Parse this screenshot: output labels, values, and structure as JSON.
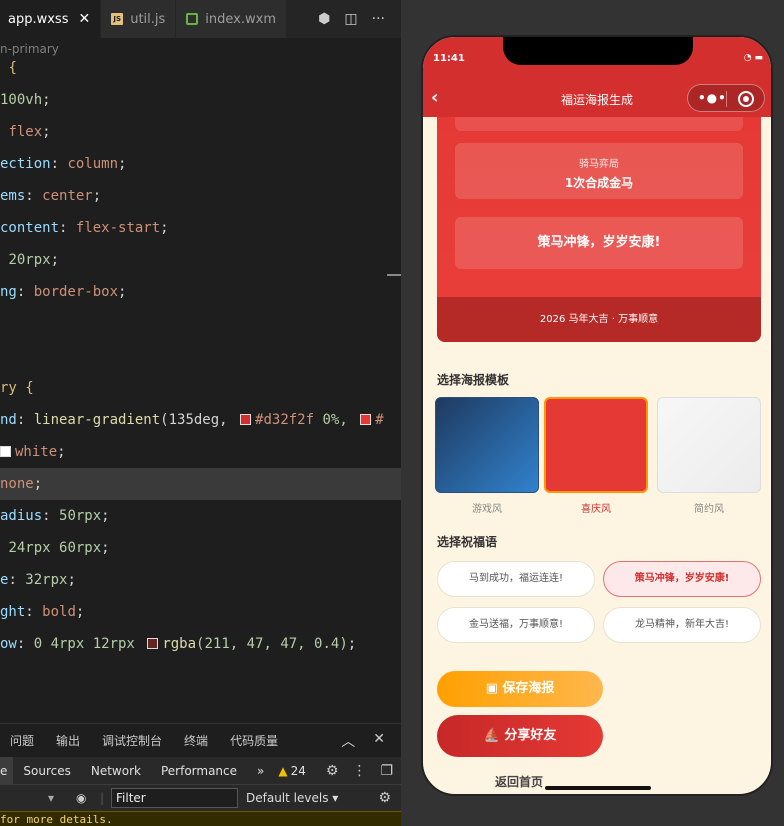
{
  "editor": {
    "tabs": [
      {
        "label": "app.wxss",
        "active": true
      },
      {
        "label": "util.js",
        "active": false
      },
      {
        "label": "index.wxm",
        "active": false
      }
    ],
    "breadcrumb": "n-primary",
    "code": {
      "l1": "{",
      "l2_num": "100vh",
      "l3_prop": "flex",
      "l4_prop": "ection",
      "l4_val": "column",
      "l5_prop": "ems",
      "l5_val": "center",
      "l6_prop": "content",
      "l6_val": "flex-start",
      "l7_num": "20rpx",
      "l8_prop": "ng",
      "l8_val": "border-box",
      "l11_sel": "ry {",
      "l12_prop": "nd",
      "l12_fn": "linear-gradient",
      "l12_a": "(135deg,",
      "l12_c1": "#d32f2f",
      "l12_b": "0%,",
      "l12_c2": "#",
      "l13_val": "white",
      "l14_val": "none",
      "l15_prop": "adius",
      "l15_num": "50rpx",
      "l16_num": "24rpx 60rpx",
      "l17_prop": "e",
      "l17_num": "32rpx",
      "l18_prop": "ght",
      "l18_val": "bold",
      "l19_prop": "ow",
      "l19_num": "0 4rpx 12rpx",
      "l19_fn": "rgba",
      "l19_args": "(211, 47, 47, 0.4)"
    },
    "panel_tabs": [
      "问题",
      "输出",
      "调试控制台",
      "终端",
      "代码质量"
    ],
    "devtools_tabs": [
      "e",
      "Sources",
      "Network",
      "Performance"
    ],
    "warnings_count": "24",
    "filter_placeholder": "Filter",
    "levels_label": "Default levels",
    "console_text": "for more details."
  },
  "phone": {
    "time": "11:41",
    "nav_title": "福运海报生成",
    "poster": {
      "card1_line1": "骑马弈局",
      "card1_line2": "1次合成金马",
      "card2_text": "策马冲锋，岁岁安康!",
      "footer": "2026 马年大吉 · 万事顺意"
    },
    "template_section_title": "选择海报模板",
    "templates": [
      {
        "label": "游戏风",
        "selected": false,
        "color": "#2b6cb0"
      },
      {
        "label": "喜庆风",
        "selected": true,
        "color": "#e53935"
      },
      {
        "label": "简约风",
        "selected": false,
        "color": "#f2f2f2"
      }
    ],
    "blessing_section_title": "选择祝福语",
    "blessings": [
      {
        "text": "马到成功，福运连连!",
        "selected": false
      },
      {
        "text": "策马冲锋，岁岁安康!",
        "selected": true
      },
      {
        "text": "金马送福，万事顺意!",
        "selected": false
      },
      {
        "text": "龙马精神，新年大吉!",
        "selected": false
      }
    ],
    "save_button": "保存海报",
    "share_button": "分享好友",
    "home_link": "返回首页"
  }
}
